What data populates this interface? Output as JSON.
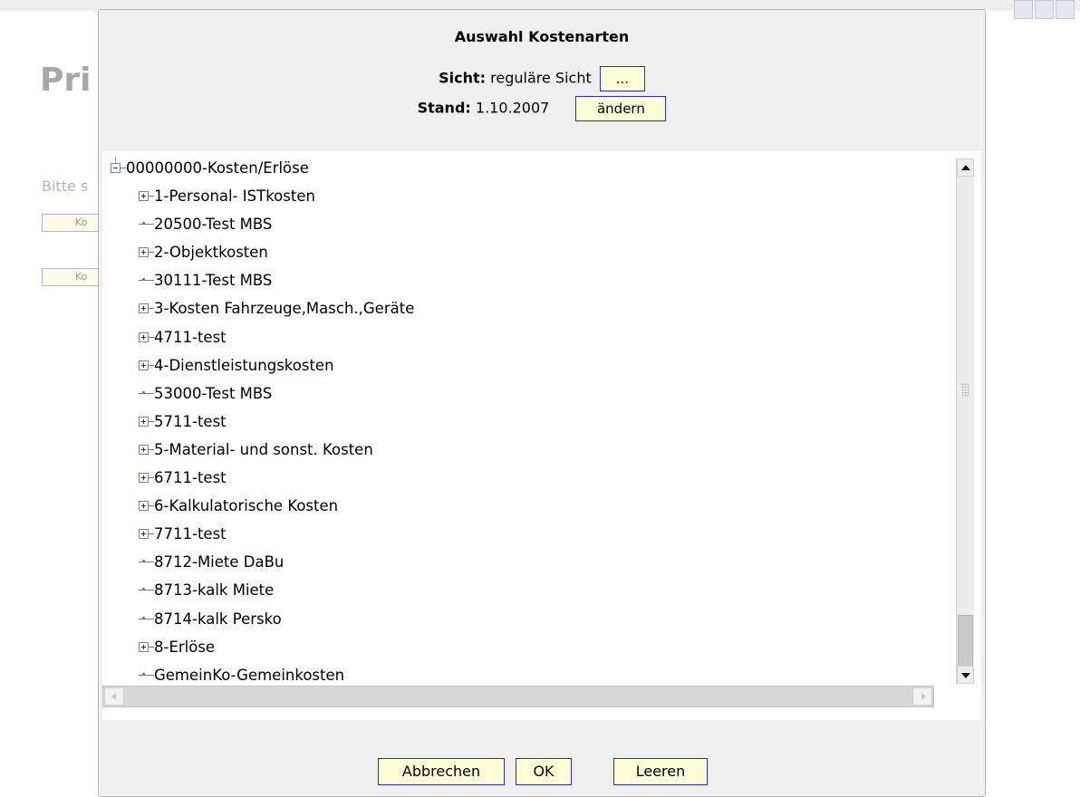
{
  "background": {
    "title": "Pri",
    "hint": "Bitte s",
    "field_buttons": [
      "Ko",
      "Ko"
    ]
  },
  "dialog": {
    "title": "Auswahl Kostenarten",
    "sicht_label": "Sicht:",
    "sicht_value": "reguläre Sicht",
    "sicht_button": "...",
    "stand_label": "Stand:",
    "stand_value": "1.10.2007",
    "stand_button": "ändern"
  },
  "tree": {
    "root": "00000000-Kosten/Erlöse",
    "items": [
      {
        "label": "1-Personal- ISTkosten",
        "expandable": true
      },
      {
        "label": "20500-Test MBS",
        "expandable": false
      },
      {
        "label": "2-Objektkosten",
        "expandable": true
      },
      {
        "label": "30111-Test MBS",
        "expandable": false
      },
      {
        "label": "3-Kosten Fahrzeuge,Masch.,Geräte",
        "expandable": true
      },
      {
        "label": "4711-test",
        "expandable": true
      },
      {
        "label": "4-Dienstleistungskosten",
        "expandable": true
      },
      {
        "label": "53000-Test MBS",
        "expandable": false
      },
      {
        "label": "5711-test",
        "expandable": true
      },
      {
        "label": "5-Material- und sonst. Kosten",
        "expandable": true
      },
      {
        "label": "6711-test",
        "expandable": true
      },
      {
        "label": "6-Kalkulatorische Kosten",
        "expandable": true
      },
      {
        "label": "7711-test",
        "expandable": true
      },
      {
        "label": "8712-Miete DaBu",
        "expandable": false
      },
      {
        "label": "8713-kalk Miete",
        "expandable": false
      },
      {
        "label": "8714-kalk Persko",
        "expandable": false
      },
      {
        "label": "8-Erlöse",
        "expandable": true
      },
      {
        "label": "GemeinKo-Gemeinkosten",
        "expandable": false
      }
    ]
  },
  "footer": {
    "cancel": "Abbrechen",
    "ok": "OK",
    "clear": "Leeren"
  },
  "colors": {
    "button_bg": "#ffffd7",
    "button_border": "#2a2ad6",
    "dialog_bg": "#f0f0f0",
    "tree_bg": "#ffffff",
    "background_text": "#a8a8a8"
  },
  "icons": {
    "expand": "plus-box-icon",
    "collapse": "minus-box-icon",
    "leaf": "tree-leaf-connector-icon"
  }
}
